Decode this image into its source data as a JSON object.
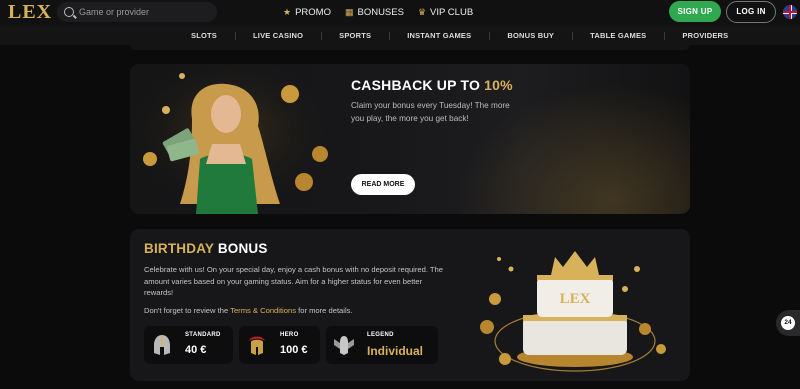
{
  "header": {
    "logo": "LEX",
    "search_placeholder": "Game or provider",
    "links": [
      {
        "label": "PROMO",
        "icon": "star-icon"
      },
      {
        "label": "BONUSES",
        "icon": "gift-icon"
      },
      {
        "label": "VIP CLUB",
        "icon": "crown-icon"
      }
    ],
    "signup_label": "SIGN UP",
    "login_label": "LOG IN",
    "language_icon": "uk-flag-icon"
  },
  "nav": {
    "items": [
      "SLOTS",
      "LIVE CASINO",
      "SPORTS",
      "INSTANT GAMES",
      "BONUS BUY",
      "TABLE GAMES",
      "PROVIDERS"
    ]
  },
  "cashback": {
    "title_prefix": "CASHBACK UP TO ",
    "title_highlight": "10%",
    "description": "Claim your bonus every Tuesday! The more you play, the more you get back!",
    "button_label": "READ MORE"
  },
  "birthday": {
    "title_highlight": "BIRTHDAY",
    "title_rest": " BONUS",
    "description": "Celebrate with us! On your special day, enjoy a cash bonus with no deposit required. The amount varies based on your gaming status. Aim for a higher status for even better rewards!",
    "note_prefix": "Don't forget to review the ",
    "note_link": "Terms & Conditions",
    "note_suffix": " for more details.",
    "tiers": [
      {
        "name": "STANDARD",
        "value": "40 €",
        "icon": "helmet-icon"
      },
      {
        "name": "HERO",
        "value": "100 €",
        "icon": "spartan-helmet-icon"
      },
      {
        "name": "LEGEND",
        "value": "Individual",
        "icon": "winged-knight-icon"
      }
    ],
    "cake_text": "LEX"
  },
  "support": {
    "label": "24"
  },
  "colors": {
    "gold": "#d8b25a",
    "green": "#2fa84f",
    "background": "#0b0b0c"
  }
}
